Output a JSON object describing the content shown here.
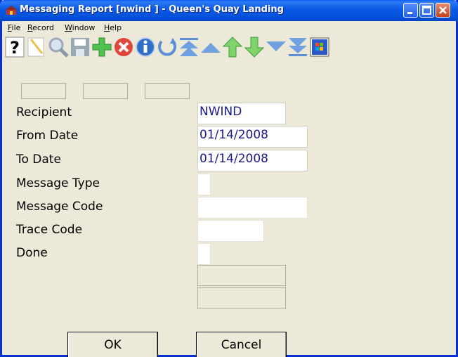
{
  "window": {
    "title": "Messaging Report [nwind   ] - Queen's Quay Landing"
  },
  "menu": [
    "File",
    "Record",
    "Window",
    "Help"
  ],
  "toolbar": {
    "icons": [
      "help-icon",
      "new-record-icon",
      "search-icon",
      "save-icon",
      "add-icon",
      "delete-icon",
      "info-icon",
      "undo-icon",
      "first-record-icon",
      "previous-page-icon",
      "previous-record-icon",
      "next-record-icon",
      "next-page-icon",
      "last-record-icon",
      "windows-icon"
    ]
  },
  "form": {
    "recipient_label": "Recipient",
    "recipient_value": "NWIND",
    "from_date_label": "From Date",
    "from_date_value": "01/14/2008",
    "to_date_label": "To Date",
    "to_date_value": "01/14/2008",
    "message_type_label": "Message Type",
    "message_type_value": "",
    "message_code_label": "Message Code",
    "message_code_value": "",
    "trace_code_label": "Trace Code",
    "trace_code_value": "",
    "done_label": "Done",
    "done_value": ""
  },
  "buttons": {
    "ok": "OK",
    "cancel": "Cancel"
  },
  "colors": {
    "titlebar": "#0553dc",
    "field_text": "#1a1a8c",
    "window_bg": "#ece9d8"
  }
}
